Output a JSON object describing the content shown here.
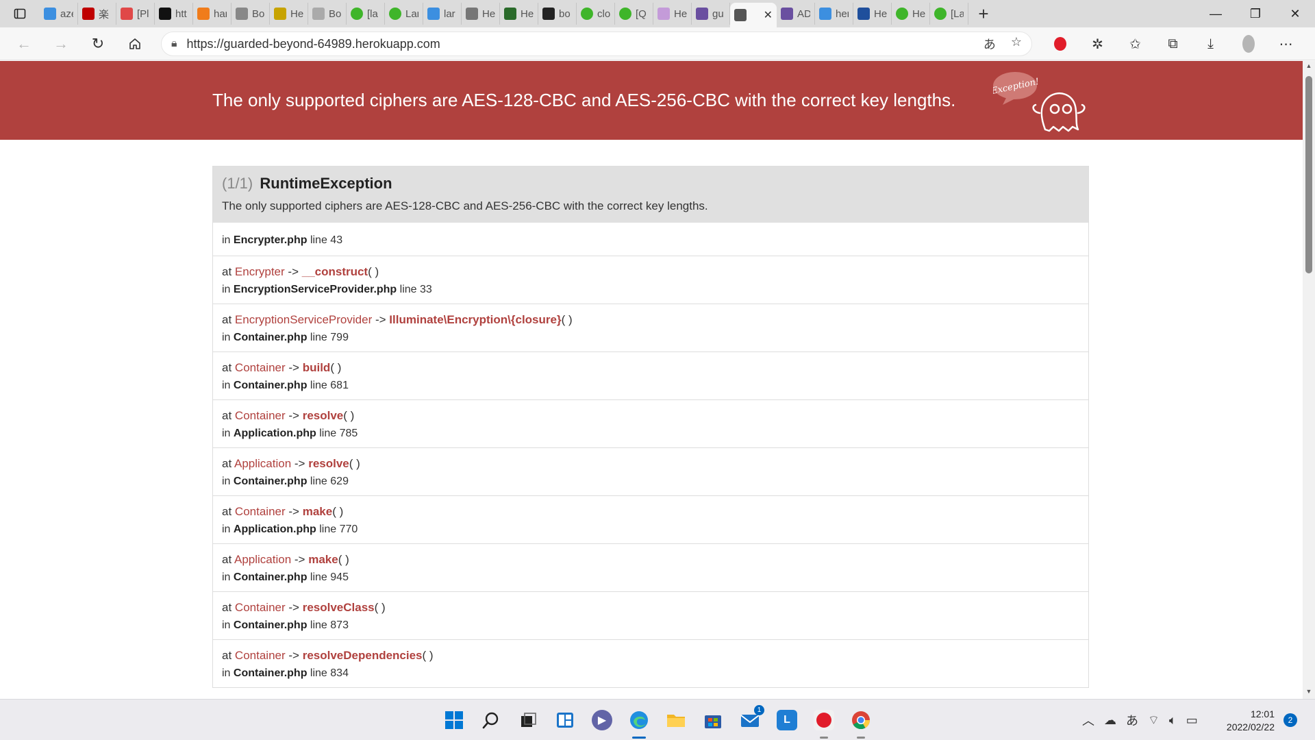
{
  "browser": {
    "tabs": [
      {
        "label": "aze",
        "icon": "bing-icon",
        "color": "#3c8fe0"
      },
      {
        "label": "楽",
        "icon": "rakuten-icon",
        "color": "#bf0000"
      },
      {
        "label": "[Pl",
        "icon": "qiita-icon",
        "color": "#e04848"
      },
      {
        "label": "htt",
        "icon": "a-icon",
        "color": "#111111"
      },
      {
        "label": "har",
        "icon": "box-icon",
        "color": "#f07c1b"
      },
      {
        "label": "Bo",
        "icon": "page-icon",
        "color": "#888888"
      },
      {
        "label": "He",
        "icon": "f-icon",
        "color": "#c7a300"
      },
      {
        "label": "Bo",
        "icon": "page-icon",
        "color": "#aaaaaa"
      },
      {
        "label": "[la",
        "icon": "green-circle-icon",
        "color": "#3fb52a"
      },
      {
        "label": "Lar",
        "icon": "green-circle-icon",
        "color": "#3fb52a"
      },
      {
        "label": "lar",
        "icon": "bing-icon",
        "color": "#3c8fe0"
      },
      {
        "label": "He",
        "icon": "g-icon",
        "color": "#777777"
      },
      {
        "label": "He",
        "icon": "turtle-icon",
        "color": "#2b6b2b"
      },
      {
        "label": "bo",
        "icon": "github-icon",
        "color": "#222222"
      },
      {
        "label": "clo",
        "icon": "green-circle-icon",
        "color": "#3fb52a"
      },
      {
        "label": "[Q",
        "icon": "green-circle-icon",
        "color": "#3fb52a"
      },
      {
        "label": "He",
        "icon": "figma-icon",
        "color": "#c49bd9"
      },
      {
        "label": "gu",
        "icon": "heroku-icon",
        "color": "#6a4fa0"
      },
      {
        "label": "",
        "icon": "page-icon",
        "color": "#555555",
        "active": true
      },
      {
        "label": "AD",
        "icon": "heroku-icon",
        "color": "#6a4fa0"
      },
      {
        "label": "her",
        "icon": "bing-icon",
        "color": "#3c8fe0"
      },
      {
        "label": "He",
        "icon": "r-icon",
        "color": "#1f4f9c"
      },
      {
        "label": "He",
        "icon": "green-circle-icon",
        "color": "#3fb52a"
      },
      {
        "label": "[La",
        "icon": "green-circle-icon",
        "color": "#3fb52a"
      }
    ],
    "url": "https://guarded-beyond-64989.herokuapp.com"
  },
  "page": {
    "banner_message": "The only supported ciphers are AES-128-CBC and AES-256-CBC with the correct key lengths.",
    "ghost_label": "Exception!",
    "exception": {
      "count": "(1/1)",
      "type": "RuntimeException",
      "message": "The only supported ciphers are AES-128-CBC and AES-256-CBC with the correct key lengths."
    },
    "frames": [
      {
        "class": "",
        "method": "",
        "file": "Encrypter.php",
        "line": "43"
      },
      {
        "class": "Encrypter",
        "method": "__construct",
        "file": "EncryptionServiceProvider.php",
        "line": "33"
      },
      {
        "class": "EncryptionServiceProvider",
        "method": "Illuminate\\Encryption\\{closure}",
        "file": "Container.php",
        "line": "799"
      },
      {
        "class": "Container",
        "method": "build",
        "file": "Container.php",
        "line": "681"
      },
      {
        "class": "Container",
        "method": "resolve",
        "file": "Application.php",
        "line": "785"
      },
      {
        "class": "Application",
        "method": "resolve",
        "file": "Container.php",
        "line": "629"
      },
      {
        "class": "Container",
        "method": "make",
        "file": "Application.php",
        "line": "770"
      },
      {
        "class": "Application",
        "method": "make",
        "file": "Container.php",
        "line": "945"
      },
      {
        "class": "Container",
        "method": "resolveClass",
        "file": "Container.php",
        "line": "873"
      },
      {
        "class": "Container",
        "method": "resolveDependencies",
        "file": "Container.php",
        "line": "834"
      }
    ],
    "labels": {
      "at": "at",
      "in": "in",
      "line": "line",
      "arrow": "->",
      "parens": "( )"
    }
  },
  "taskbar": {
    "mail_badge": "1",
    "ime": "あ",
    "time": "12:01",
    "date": "2022/02/22",
    "notifications": "2"
  }
}
